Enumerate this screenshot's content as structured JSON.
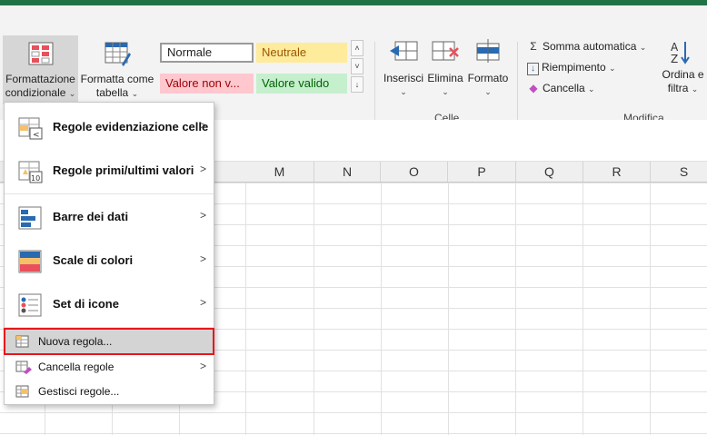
{
  "ribbon": {
    "cond_format": {
      "line1": "Formattazione",
      "line2": "condizionale"
    },
    "format_table": {
      "line1": "Formatta come",
      "line2": "tabella"
    },
    "styles": {
      "normal": "Normale",
      "neutral": "Neutrale",
      "bad": "Valore non v...",
      "good": "Valore valido"
    },
    "cells": {
      "insert": "Inserisci",
      "delete": "Elimina",
      "format": "Formato",
      "group_label": "Celle"
    },
    "editing": {
      "autosum": "Somma automatica",
      "fill": "Riempimento",
      "clear": "Cancella",
      "sort_line1": "Ordina e",
      "sort_line2": "filtra",
      "group_label": "Modifica"
    },
    "colors": {
      "normal_bg": "#ffffff",
      "neutral_bg": "#ffeb9c",
      "neutral_fg": "#9c5700",
      "bad_bg": "#ffc7ce",
      "bad_fg": "#9c0006",
      "good_bg": "#c6efce",
      "good_fg": "#006100",
      "brand": "#217346"
    }
  },
  "columns": [
    "M",
    "N",
    "O",
    "P",
    "Q",
    "R",
    "S"
  ],
  "menu": {
    "items": [
      {
        "label": "Regole evidenziazione celle",
        "icon": "highlight-rules-icon",
        "submenu": true
      },
      {
        "label": "Regole primi/ultimi valori",
        "icon": "top-bottom-rules-icon",
        "submenu": true
      },
      {
        "label": "Barre dei dati",
        "icon": "data-bars-icon",
        "submenu": true
      },
      {
        "label": "Scale di colori",
        "icon": "color-scales-icon",
        "submenu": true
      },
      {
        "label": "Set di icone",
        "icon": "icon-sets-icon",
        "submenu": true
      },
      {
        "label": "Nuova regola...",
        "icon": "new-rule-icon",
        "submenu": false,
        "highlighted": true
      },
      {
        "label": "Cancella regole",
        "icon": "clear-rules-icon",
        "submenu": true
      },
      {
        "label": "Gestisci regole...",
        "icon": "manage-rules-icon",
        "submenu": false
      }
    ],
    "submenu_arrow": ">"
  }
}
